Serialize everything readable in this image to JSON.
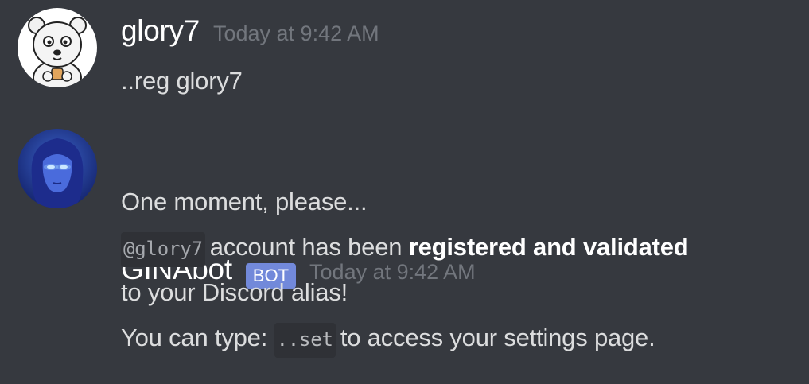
{
  "messages": [
    {
      "username": "glory7",
      "timestamp": "Today at 9:42 AM",
      "avatar_icon": "polar-bear-avatar",
      "lines": [
        "..reg glory7"
      ]
    },
    {
      "username": "GINAbot",
      "badge": "BOT",
      "timestamp": "Today at 9:42 AM",
      "avatar_icon": "blue-woman-avatar",
      "line1": "One moment, please...",
      "line2": {
        "mention": "@glory7",
        "text": "account has been",
        "bold": "registered and validated"
      },
      "line3": "to your Discord alias!",
      "line4": {
        "prefix": "You can type:",
        "code": "..set",
        "suffix": "to access your settings page."
      }
    }
  ],
  "colors": {
    "background": "#36393f",
    "username": "#ffffff",
    "timestamp": "#72767d",
    "text": "#dcddde",
    "bot_badge": "#7289da",
    "code_bg": "#2f3136"
  }
}
